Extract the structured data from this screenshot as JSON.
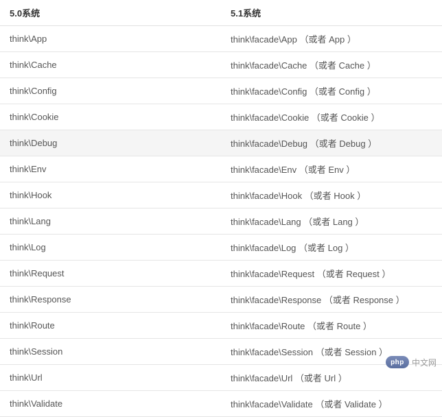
{
  "table": {
    "headers": [
      "5.0系统",
      "5.1系统"
    ],
    "rows": [
      {
        "left": "think\\App",
        "right": "think\\facade\\App （或者 App ）",
        "hover": false
      },
      {
        "left": "think\\Cache",
        "right": "think\\facade\\Cache （或者 Cache ）",
        "hover": false
      },
      {
        "left": "think\\Config",
        "right": "think\\facade\\Config （或者 Config ）",
        "hover": false
      },
      {
        "left": "think\\Cookie",
        "right": "think\\facade\\Cookie （或者 Cookie ）",
        "hover": false
      },
      {
        "left": "think\\Debug",
        "right": "think\\facade\\Debug （或者 Debug ）",
        "hover": true
      },
      {
        "left": "think\\Env",
        "right": "think\\facade\\Env （或者 Env ）",
        "hover": false
      },
      {
        "left": "think\\Hook",
        "right": "think\\facade\\Hook （或者 Hook ）",
        "hover": false
      },
      {
        "left": "think\\Lang",
        "right": "think\\facade\\Lang （或者 Lang ）",
        "hover": false
      },
      {
        "left": "think\\Log",
        "right": "think\\facade\\Log （或者 Log ）",
        "hover": false
      },
      {
        "left": "think\\Request",
        "right": "think\\facade\\Request （或者 Request ）",
        "hover": false
      },
      {
        "left": "think\\Response",
        "right": "think\\facade\\Response （或者 Response ）",
        "hover": false
      },
      {
        "left": "think\\Route",
        "right": "think\\facade\\Route （或者 Route ）",
        "hover": false
      },
      {
        "left": "think\\Session",
        "right": "think\\facade\\Session （或者 Session ）",
        "hover": false
      },
      {
        "left": "think\\Url",
        "right": "think\\facade\\Url （或者 Url ）",
        "hover": false
      },
      {
        "left": "think\\Validate",
        "right": "think\\facade\\Validate （或者 Validate ）",
        "hover": false
      }
    ]
  },
  "watermark": {
    "logo": "php",
    "text": "中文网"
  }
}
